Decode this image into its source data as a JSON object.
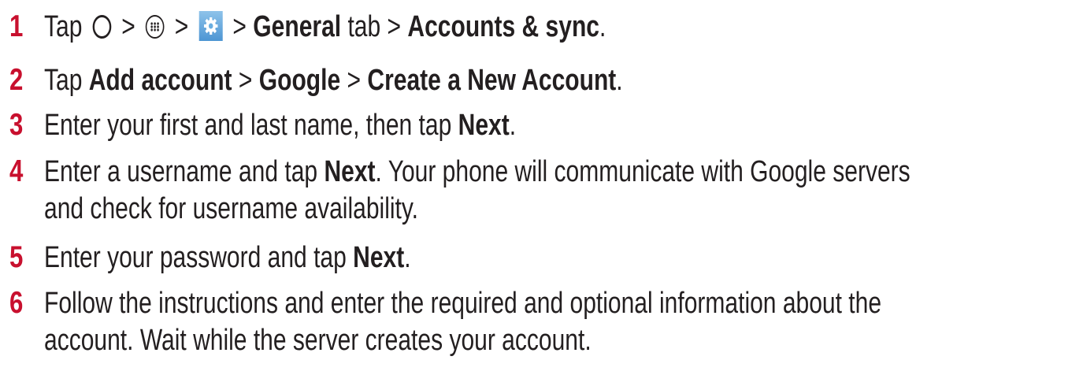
{
  "steps": [
    {
      "number": "1",
      "tap": "Tap",
      "sep": ">",
      "general": "General",
      "tab": "tab",
      "accounts_sync": "Accounts & sync",
      "end": ".",
      "icons": [
        "home-icon",
        "apps-icon",
        "settings-icon"
      ]
    },
    {
      "number": "2",
      "tap": "Tap",
      "add_account": "Add account",
      "sep": ">",
      "google": "Google",
      "create": "Create a New Account",
      "end": "."
    },
    {
      "number": "3",
      "text": "Enter your first and last name, then tap",
      "next": "Next",
      "end": "."
    },
    {
      "number": "4",
      "text_a": "Enter a username and tap",
      "next": "Next",
      "text_b": ". Your phone will communicate with Google servers",
      "line2": "and check for username availability."
    },
    {
      "number": "5",
      "text": "Enter your password and tap",
      "next": "Next",
      "end": "."
    },
    {
      "number": "6",
      "line1": "Follow the instructions and enter the required and optional information about the",
      "line2": "account. Wait while the server creates your account."
    }
  ],
  "colors": {
    "step_number": "#c8102e",
    "body_text": "#231f20",
    "settings_icon_top": "#8ec3ea",
    "settings_icon_bottom": "#4d95d3"
  }
}
